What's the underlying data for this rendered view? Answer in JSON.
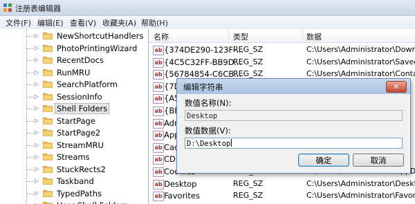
{
  "window": {
    "title": "注册表编辑器",
    "icon": "registry-editor-icon"
  },
  "menu": [
    "文件(F)",
    "编辑(E)",
    "查看(V)",
    "收藏夹(A)",
    "帮助(H)"
  ],
  "tree": {
    "items": [
      {
        "label": "NewShortcutHandlers"
      },
      {
        "label": "PhotoPrintingWizard"
      },
      {
        "label": "RecentDocs"
      },
      {
        "label": "RunMRU"
      },
      {
        "label": "SearchPlatform"
      },
      {
        "label": "SessionInfo"
      },
      {
        "label": "Shell Folders",
        "selected": true
      },
      {
        "label": "StartPage"
      },
      {
        "label": "StartPage2"
      },
      {
        "label": "StreamMRU"
      },
      {
        "label": "Streams"
      },
      {
        "label": "StuckRects2"
      },
      {
        "label": "Taskband"
      },
      {
        "label": "TypedPaths"
      },
      {
        "label": "User Shell Folders"
      }
    ]
  },
  "list": {
    "columns": {
      "name": "名称",
      "type": "类型",
      "data": "数据"
    },
    "rows": [
      {
        "name": "{374DE290-123F-...",
        "type": "REG_SZ",
        "data": "C:\\Users\\Administrator\\Downlo"
      },
      {
        "name": "{4C5C32FF-BB9D...",
        "type": "REG_SZ",
        "data": "C:\\Users\\Administrator\\Saved"
      },
      {
        "name": "{56784854-C6CB...",
        "type": "REG_SZ",
        "data": "C:\\Users\\Administrator\\Conta"
      },
      {
        "name": "{7D",
        "type": "",
        "data": ""
      },
      {
        "name": "{A5",
        "type": "",
        "data": ""
      },
      {
        "name": "{BF",
        "type": "",
        "data": ""
      },
      {
        "name": "Adr",
        "type": "",
        "data": ""
      },
      {
        "name": "App",
        "type": "",
        "data": ""
      },
      {
        "name": "Cac",
        "type": "",
        "data": ""
      },
      {
        "name": "CD",
        "type": "",
        "data": ""
      },
      {
        "name": "Cookies",
        "type": "REG_SZ",
        "data": "C:\\Users\\Administrator\\AppDa"
      },
      {
        "name": "Desktop",
        "type": "REG_SZ",
        "data": "C:\\Users\\Administrator\\Deskto"
      },
      {
        "name": "Favorites",
        "type": "REG_SZ",
        "data": "C:\\Users\\Administrator\\Favorit"
      }
    ]
  },
  "dialog": {
    "title": "编辑字符串",
    "close_label": "✕",
    "name_label": "数值名称(N):",
    "name_value": "Desktop",
    "data_label": "数值数据(V):",
    "data_value": "D:\\Desktop",
    "ok_label": "确定",
    "cancel_label": "取消"
  }
}
